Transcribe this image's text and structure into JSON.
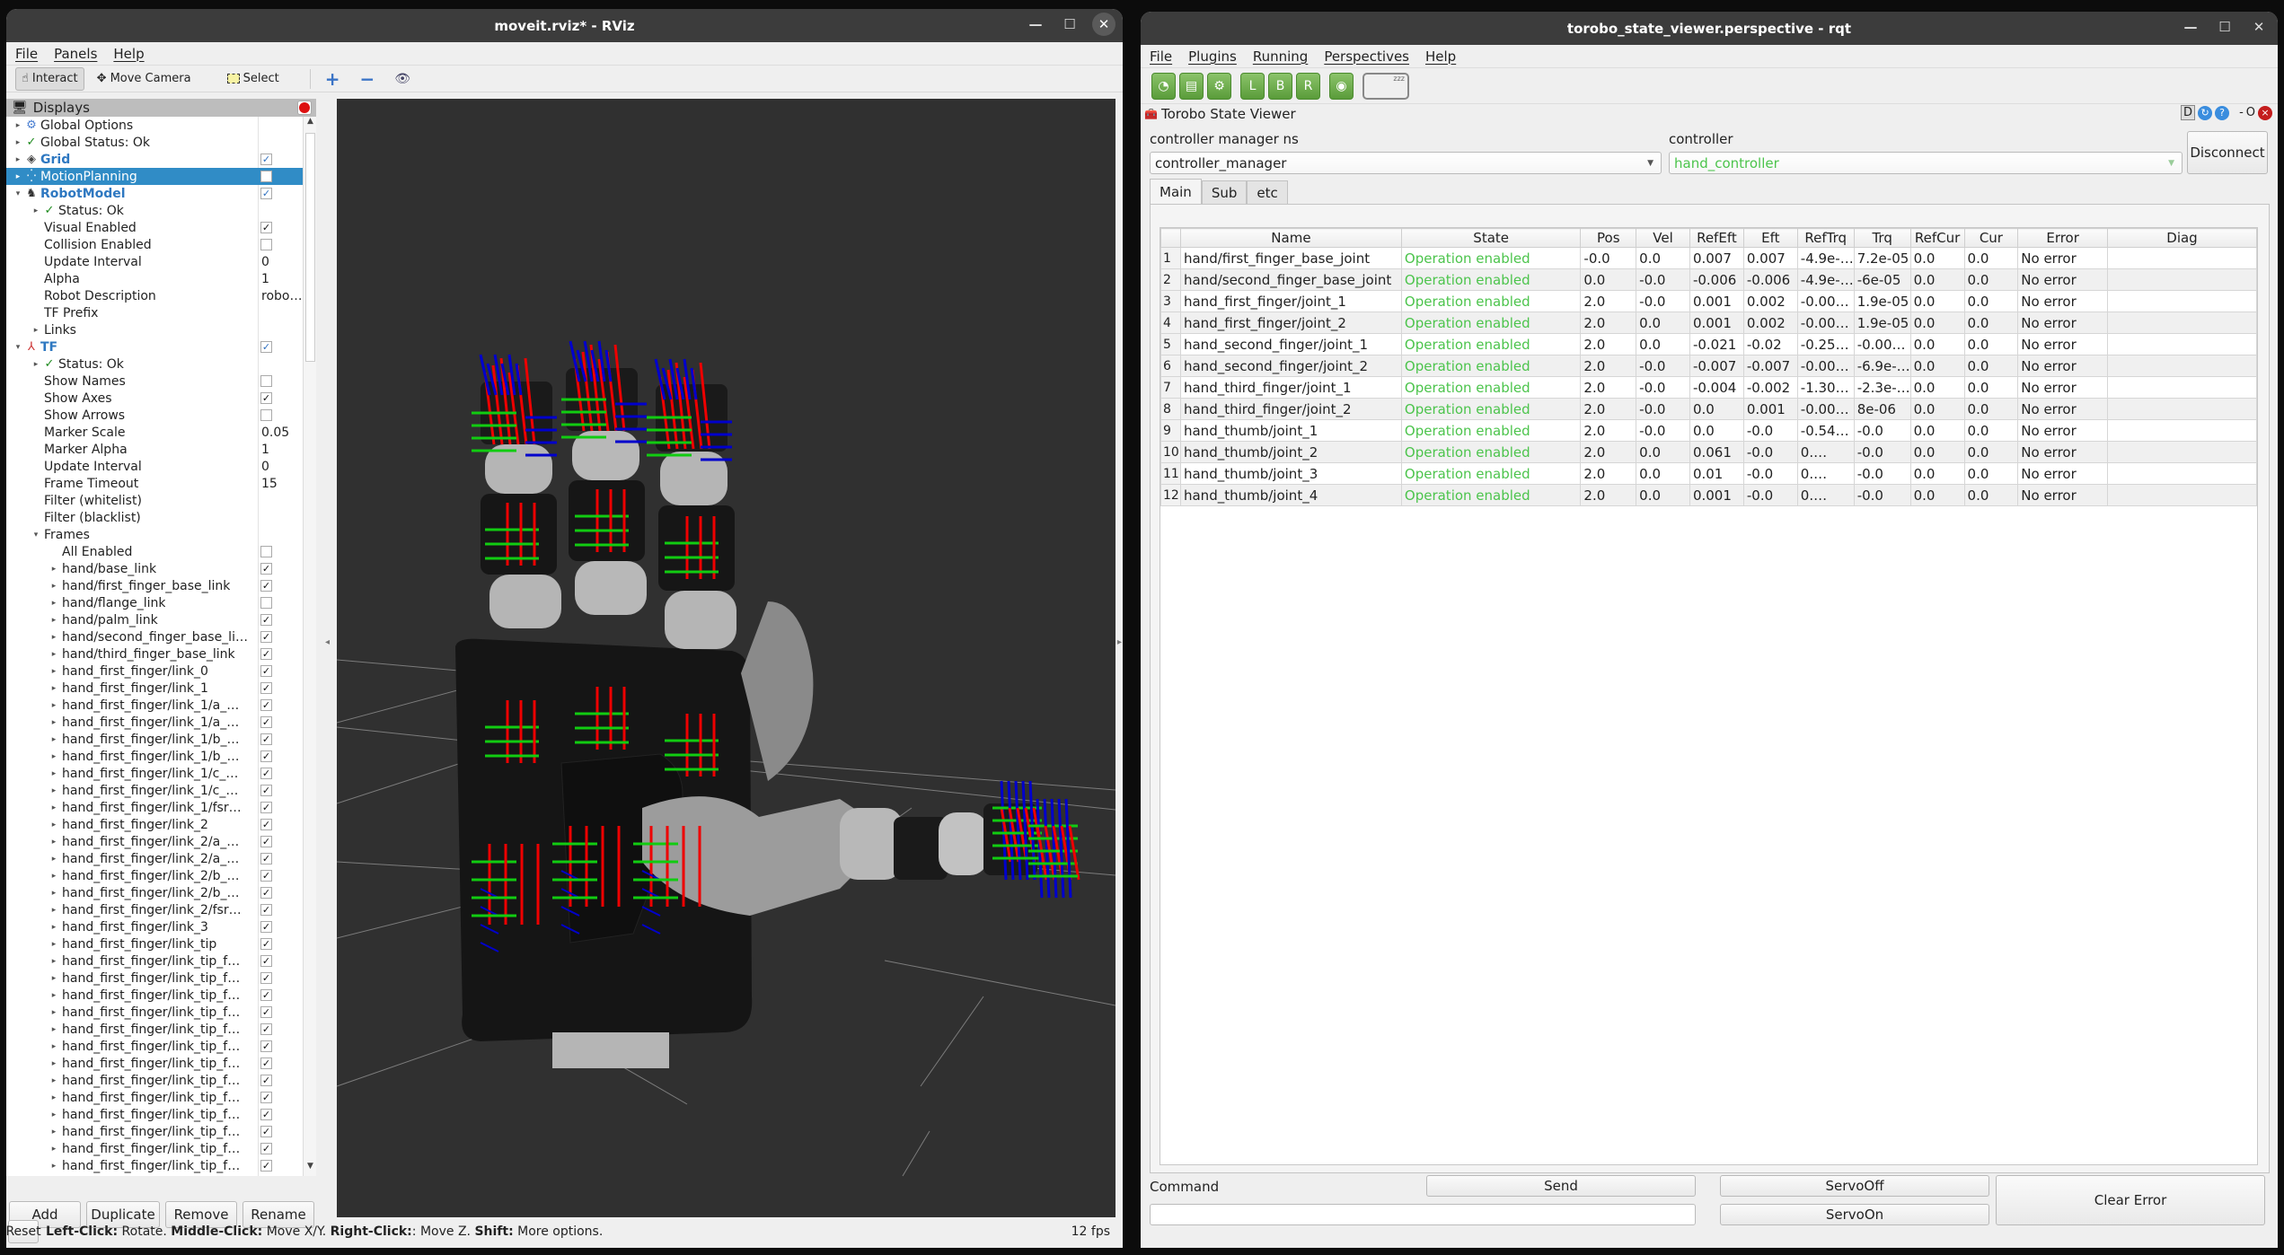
{
  "rviz": {
    "title": "moveit.rviz* - RViz",
    "window_controls": {
      "minimize": "—",
      "maximize": "☐",
      "close": "✕"
    },
    "menu": [
      "File",
      "Panels",
      "Help"
    ],
    "toolbar": {
      "interact": "Interact",
      "move_camera": "Move Camera",
      "select": "Select",
      "add_icon": "+",
      "remove_icon": "−",
      "eye_icon": "👁"
    },
    "displays_title": "Displays",
    "tree": [
      {
        "label": "Global Options",
        "indent": 0,
        "arrow": "▸",
        "icon": "gear-icon",
        "glyph": "⚙",
        "iconColor": "#4a7fd1"
      },
      {
        "label": "Global Status: Ok",
        "indent": 0,
        "arrow": "▸",
        "icon": "check-icon",
        "glyph": "✓",
        "iconColor": "#1e8a1e"
      },
      {
        "label": "Grid",
        "indent": 0,
        "arrow": "▸",
        "icon": "grid-icon",
        "glyph": "◈",
        "iconColor": "#444",
        "bold": true,
        "check": "on-blue"
      },
      {
        "label": "MotionPlanning",
        "indent": 0,
        "arrow": "▸",
        "icon": "motion-planning-icon",
        "glyph": "⁛",
        "iconColor": "#fff",
        "selected": true,
        "check": "off"
      },
      {
        "label": "RobotModel",
        "indent": 0,
        "arrow": "▾",
        "icon": "robot-icon",
        "glyph": "♞",
        "iconColor": "#333",
        "bold": true,
        "check": "on-blue"
      },
      {
        "label": "Status: Ok",
        "indent": 1,
        "arrow": "▸",
        "icon": "check-icon",
        "glyph": "✓",
        "iconColor": "#1e8a1e"
      },
      {
        "label": "Visual Enabled",
        "indent": 1,
        "check": "on"
      },
      {
        "label": "Collision Enabled",
        "indent": 1,
        "check": "off"
      },
      {
        "label": "Update Interval",
        "indent": 1,
        "value": "0"
      },
      {
        "label": "Alpha",
        "indent": 1,
        "value": "1"
      },
      {
        "label": "Robot Description",
        "indent": 1,
        "value": "robo…"
      },
      {
        "label": "TF Prefix",
        "indent": 1
      },
      {
        "label": "Links",
        "indent": 1,
        "arrow": "▸"
      },
      {
        "label": "TF",
        "indent": 0,
        "arrow": "▾",
        "icon": "tf-axes-icon",
        "glyph": "⅄",
        "iconColor": "#c33",
        "bold": true,
        "check": "on-blue"
      },
      {
        "label": "Status: Ok",
        "indent": 1,
        "arrow": "▸",
        "icon": "check-icon",
        "glyph": "✓",
        "iconColor": "#1e8a1e"
      },
      {
        "label": "Show Names",
        "indent": 1,
        "check": "off"
      },
      {
        "label": "Show Axes",
        "indent": 1,
        "check": "on"
      },
      {
        "label": "Show Arrows",
        "indent": 1,
        "check": "off"
      },
      {
        "label": "Marker Scale",
        "indent": 1,
        "value": "0.05"
      },
      {
        "label": "Marker Alpha",
        "indent": 1,
        "value": "1"
      },
      {
        "label": "Update Interval",
        "indent": 1,
        "value": "0"
      },
      {
        "label": "Frame Timeout",
        "indent": 1,
        "value": "15"
      },
      {
        "label": "Filter (whitelist)",
        "indent": 1
      },
      {
        "label": "Filter (blacklist)",
        "indent": 1
      },
      {
        "label": "Frames",
        "indent": 1,
        "arrow": "▾"
      },
      {
        "label": "All Enabled",
        "indent": 2,
        "check": "off"
      },
      {
        "label": "hand/base_link",
        "indent": 2,
        "arrow": "▸",
        "check": "on"
      },
      {
        "label": "hand/first_finger_base_link",
        "indent": 2,
        "arrow": "▸",
        "check": "on"
      },
      {
        "label": "hand/flange_link",
        "indent": 2,
        "arrow": "▸",
        "check": "off"
      },
      {
        "label": "hand/palm_link",
        "indent": 2,
        "arrow": "▸",
        "check": "on"
      },
      {
        "label": "hand/second_finger_base_li…",
        "indent": 2,
        "arrow": "▸",
        "check": "on"
      },
      {
        "label": "hand/third_finger_base_link",
        "indent": 2,
        "arrow": "▸",
        "check": "on"
      },
      {
        "label": "hand_first_finger/link_0",
        "indent": 2,
        "arrow": "▸",
        "check": "on"
      },
      {
        "label": "hand_first_finger/link_1",
        "indent": 2,
        "arrow": "▸",
        "check": "on"
      },
      {
        "label": "hand_first_finger/link_1/a_…",
        "indent": 2,
        "arrow": "▸",
        "check": "on"
      },
      {
        "label": "hand_first_finger/link_1/a_…",
        "indent": 2,
        "arrow": "▸",
        "check": "on"
      },
      {
        "label": "hand_first_finger/link_1/b_…",
        "indent": 2,
        "arrow": "▸",
        "check": "on"
      },
      {
        "label": "hand_first_finger/link_1/b_…",
        "indent": 2,
        "arrow": "▸",
        "check": "on"
      },
      {
        "label": "hand_first_finger/link_1/c_…",
        "indent": 2,
        "arrow": "▸",
        "check": "on"
      },
      {
        "label": "hand_first_finger/link_1/c_…",
        "indent": 2,
        "arrow": "▸",
        "check": "on"
      },
      {
        "label": "hand_first_finger/link_1/fsr…",
        "indent": 2,
        "arrow": "▸",
        "check": "on"
      },
      {
        "label": "hand_first_finger/link_2",
        "indent": 2,
        "arrow": "▸",
        "check": "on"
      },
      {
        "label": "hand_first_finger/link_2/a_…",
        "indent": 2,
        "arrow": "▸",
        "check": "on"
      },
      {
        "label": "hand_first_finger/link_2/a_…",
        "indent": 2,
        "arrow": "▸",
        "check": "on"
      },
      {
        "label": "hand_first_finger/link_2/b_…",
        "indent": 2,
        "arrow": "▸",
        "check": "on"
      },
      {
        "label": "hand_first_finger/link_2/b_…",
        "indent": 2,
        "arrow": "▸",
        "check": "on"
      },
      {
        "label": "hand_first_finger/link_2/fsr…",
        "indent": 2,
        "arrow": "▸",
        "check": "on"
      },
      {
        "label": "hand_first_finger/link_3",
        "indent": 2,
        "arrow": "▸",
        "check": "on"
      },
      {
        "label": "hand_first_finger/link_tip",
        "indent": 2,
        "arrow": "▸",
        "check": "on"
      },
      {
        "label": "hand_first_finger/link_tip_f…",
        "indent": 2,
        "arrow": "▸",
        "check": "on"
      },
      {
        "label": "hand_first_finger/link_tip_f…",
        "indent": 2,
        "arrow": "▸",
        "check": "on"
      },
      {
        "label": "hand_first_finger/link_tip_f…",
        "indent": 2,
        "arrow": "▸",
        "check": "on"
      },
      {
        "label": "hand_first_finger/link_tip_f…",
        "indent": 2,
        "arrow": "▸",
        "check": "on"
      },
      {
        "label": "hand_first_finger/link_tip_f…",
        "indent": 2,
        "arrow": "▸",
        "check": "on"
      },
      {
        "label": "hand_first_finger/link_tip_f…",
        "indent": 2,
        "arrow": "▸",
        "check": "on"
      },
      {
        "label": "hand_first_finger/link_tip_f…",
        "indent": 2,
        "arrow": "▸",
        "check": "on"
      },
      {
        "label": "hand_first_finger/link_tip_f…",
        "indent": 2,
        "arrow": "▸",
        "check": "on"
      },
      {
        "label": "hand_first_finger/link_tip_f…",
        "indent": 2,
        "arrow": "▸",
        "check": "on"
      },
      {
        "label": "hand_first_finger/link_tip_f…",
        "indent": 2,
        "arrow": "▸",
        "check": "on"
      },
      {
        "label": "hand_first_finger/link_tip_f…",
        "indent": 2,
        "arrow": "▸",
        "check": "on"
      },
      {
        "label": "hand_first_finger/link_tip_f…",
        "indent": 2,
        "arrow": "▸",
        "check": "on"
      },
      {
        "label": "hand_first_finger/link_tip_f…",
        "indent": 2,
        "arrow": "▸",
        "check": "on"
      }
    ],
    "buttons": {
      "add": "Add",
      "duplicate": "Duplicate",
      "remove": "Remove",
      "rename": "Rename"
    },
    "status": {
      "reset": "Reset",
      "k1": "Left-Click:",
      "v1": " Rotate. ",
      "k2": "Middle-Click:",
      "v2": " Move X/Y. ",
      "k3": "Right-Click:",
      "v3": ": Move Z. ",
      "k4": "Shift:",
      "v4": " More options.",
      "fps": "12 fps"
    }
  },
  "rqt": {
    "title": "torobo_state_viewer.perspective - rqt",
    "window_controls": {
      "minimize": "—",
      "maximize": "☐",
      "close": "✕"
    },
    "menu": [
      "File",
      "Plugins",
      "Running",
      "Perspectives",
      "Help"
    ],
    "toolbar": [
      {
        "name": "gauge-icon",
        "glyph": "◔"
      },
      {
        "name": "notes-icon",
        "glyph": "▤"
      },
      {
        "name": "settings-icon",
        "glyph": "⚙"
      },
      {
        "name": "arm-left-icon",
        "glyph": "L"
      },
      {
        "name": "arm-both-icon",
        "glyph": "B"
      },
      {
        "name": "arm-right-icon",
        "glyph": "R"
      },
      {
        "name": "target-icon",
        "glyph": "◉"
      }
    ],
    "sleep_label": "zzz",
    "plugin_title": "Torobo State Viewer",
    "plugin_controls": {
      "d": "D",
      "reload": "↻",
      "help": "?",
      "min": "-",
      "o": "O",
      "close": "×"
    },
    "ns_label": "controller manager ns",
    "ns_value": "controller_manager",
    "controller_label": "controller",
    "controller_value": "hand_controller",
    "disconnect": "Disconnect",
    "tabs": [
      "Main",
      "Sub",
      "etc"
    ],
    "columns": [
      "Name",
      "State",
      "Pos",
      "Vel",
      "RefEft",
      "Eft",
      "RefTrq",
      "Trq",
      "RefCur",
      "Cur",
      "Error",
      "Diag"
    ],
    "rows": [
      [
        "hand/first_finger_base_joint",
        "Operation enabled",
        "-0.0",
        "0.0",
        "0.007",
        "0.007",
        "-4.9e-…",
        "7.2e-05",
        "0.0",
        "0.0",
        "No error",
        ""
      ],
      [
        "hand/second_finger_base_joint",
        "Operation enabled",
        "0.0",
        "-0.0",
        "-0.006",
        "-0.006",
        "-4.9e-…",
        "-6e-05",
        "0.0",
        "0.0",
        "No error",
        ""
      ],
      [
        "hand_first_finger/joint_1",
        "Operation enabled",
        "2.0",
        "-0.0",
        "0.001",
        "0.002",
        "-0.00…",
        "1.9e-05",
        "0.0",
        "0.0",
        "No error",
        ""
      ],
      [
        "hand_first_finger/joint_2",
        "Operation enabled",
        "2.0",
        "0.0",
        "0.001",
        "0.002",
        "-0.00…",
        "1.9e-05",
        "0.0",
        "0.0",
        "No error",
        ""
      ],
      [
        "hand_second_finger/joint_1",
        "Operation enabled",
        "2.0",
        "0.0",
        "-0.021",
        "-0.02",
        "-0.25…",
        "-0.00…",
        "0.0",
        "0.0",
        "No error",
        ""
      ],
      [
        "hand_second_finger/joint_2",
        "Operation enabled",
        "2.0",
        "-0.0",
        "-0.007",
        "-0.007",
        "-0.00…",
        "-6.9e-…",
        "0.0",
        "0.0",
        "No error",
        ""
      ],
      [
        "hand_third_finger/joint_1",
        "Operation enabled",
        "2.0",
        "-0.0",
        "-0.004",
        "-0.002",
        "-1.30…",
        "-2.3e-…",
        "0.0",
        "0.0",
        "No error",
        ""
      ],
      [
        "hand_third_finger/joint_2",
        "Operation enabled",
        "2.0",
        "-0.0",
        "0.0",
        "0.001",
        "-0.00…",
        "8e-06",
        "0.0",
        "0.0",
        "No error",
        ""
      ],
      [
        "hand_thumb/joint_1",
        "Operation enabled",
        "2.0",
        "-0.0",
        "0.0",
        "-0.0",
        "-0.54…",
        "-0.0",
        "0.0",
        "0.0",
        "No error",
        ""
      ],
      [
        "hand_thumb/joint_2",
        "Operation enabled",
        "2.0",
        "0.0",
        "0.061",
        "-0.0",
        "0.…",
        "-0.0",
        "0.0",
        "0.0",
        "No error",
        ""
      ],
      [
        "hand_thumb/joint_3",
        "Operation enabled",
        "2.0",
        "0.0",
        "0.01",
        "-0.0",
        "0.…",
        "-0.0",
        "0.0",
        "0.0",
        "No error",
        ""
      ],
      [
        "hand_thumb/joint_4",
        "Operation enabled",
        "2.0",
        "0.0",
        "0.001",
        "-0.0",
        "0.…",
        "-0.0",
        "0.0",
        "0.0",
        "No error",
        ""
      ]
    ],
    "command_label": "Command",
    "command_value": "",
    "send": "Send",
    "servo_off": "ServoOff",
    "servo_on": "ServoOn",
    "clear_error": "Clear Error",
    "state_color": "#4cc44c"
  }
}
